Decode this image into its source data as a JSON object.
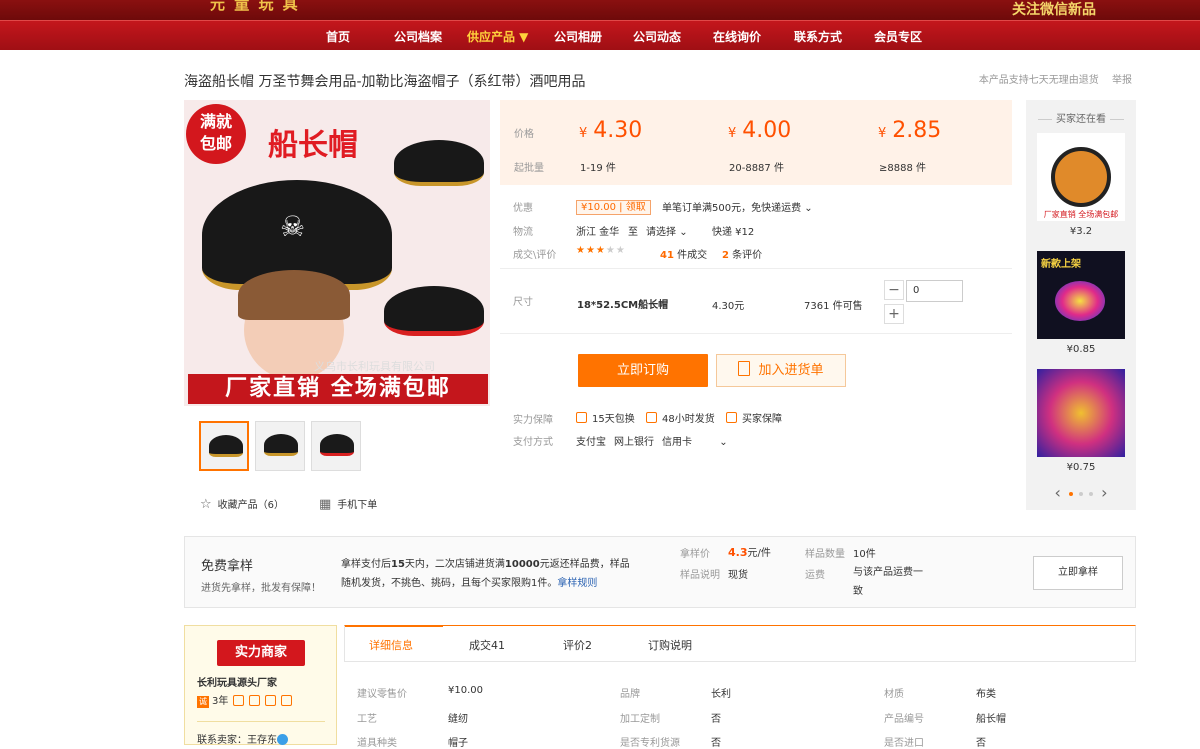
{
  "topbar": {
    "brand": "元 童 玩 具",
    "wechat": "关注微信新品"
  },
  "nav": [
    "首页",
    "公司档案",
    "供应产品 ▼",
    "公司相册",
    "公司动态",
    "在线询价",
    "联系方式",
    "会员专区"
  ],
  "product": {
    "title": "海盗船长帽 万圣节舞会用品-加勒比海盗帽子（系红带）酒吧用品",
    "top_links": [
      "本产品支持七天无理由退货",
      "举报"
    ],
    "image": {
      "badge": "满就\n包邮",
      "title": "船长帽",
      "watermark": "义乌市长利玩具有限公司",
      "slogan": "厂家直销  全场满包邮"
    },
    "favorite": "收藏产品（6）",
    "mobile": "手机下单"
  },
  "price": {
    "price_label": "价格",
    "moq_label": "起批量",
    "currency": "¥",
    "tiers": [
      {
        "price": "4.30",
        "qty": "1-19 件"
      },
      {
        "price": "4.00",
        "qty": "20-8887 件"
      },
      {
        "price": "2.85",
        "qty": "≥8888 件"
      }
    ]
  },
  "attrs": {
    "promo_label": "优惠",
    "coupon_value": "¥10.00",
    "coupon_get": "领取",
    "promo_text": "单笔订单满500元，免快递运费",
    "logistics_label": "物流",
    "from": "浙江 金华",
    "to_label": "至",
    "to": "请选择",
    "express": "快递 ¥12",
    "rating_label": "成交\\评价",
    "deals_count": "41",
    "deals_text": "件成交",
    "reviews_count": "2",
    "reviews_text": "条评价",
    "stars": 3,
    "size_label": "尺寸",
    "size_name": "18*52.5CM船长帽",
    "size_price": "4.30元",
    "size_stock": "7361 件可售",
    "qty_value": "0",
    "buy_now": "立即订购",
    "add_cart": "加入进货单",
    "guarantee_label": "实力保障",
    "guarantees": [
      "15天包换",
      "48小时发货",
      "买家保障"
    ],
    "payment_label": "支付方式",
    "payments": [
      "支付宝",
      "网上银行",
      "信用卡"
    ]
  },
  "sidebar": {
    "title": "买家还在看",
    "items": [
      {
        "price": "¥3.2"
      },
      {
        "price": "¥0.85"
      },
      {
        "price": "¥0.75"
      }
    ]
  },
  "sample": {
    "title": "免费拿样",
    "subtitle": "进货先拿样，批发有保障！",
    "desc_a": "拿样支付后",
    "desc_b": "15",
    "desc_c": "天内，二次店铺进货满",
    "desc_d": "10000",
    "desc_e": "元返还样品费，样品随机发货，不挑色、挑码，且每个买家限购1件。",
    "rules": "拿样规则",
    "price_label": "拿样价",
    "price_value": "4.3",
    "price_unit": "元/件",
    "qty_label": "样品数量",
    "qty_value": "10件",
    "note_label": "样品说明",
    "note_value": "现货",
    "freight_label": "运费",
    "freight_value": "与该产品运费一致",
    "button": "立即拿样"
  },
  "shop": {
    "badge": "实力商家",
    "name": "长利玩具源头厂家",
    "years": "3年",
    "year_icon": "诚",
    "contact": "联系卖家：王存东"
  },
  "detail": {
    "tabs": [
      "详细信息",
      "成交41",
      "评价2",
      "订购说明"
    ],
    "rows": [
      [
        "建议零售价",
        "¥10.00",
        "品牌",
        "长利",
        "材质",
        "布类"
      ],
      [
        "工艺",
        "缝纫",
        "加工定制",
        "否",
        "产品编号",
        "船长帽"
      ],
      [
        "道具种类",
        "帽子",
        "是否专利货源",
        "否",
        "是否进口",
        "否"
      ]
    ]
  },
  "colors": {
    "accent": "#ff7300",
    "nav": "#c4161c",
    "price": "#ff5000"
  }
}
